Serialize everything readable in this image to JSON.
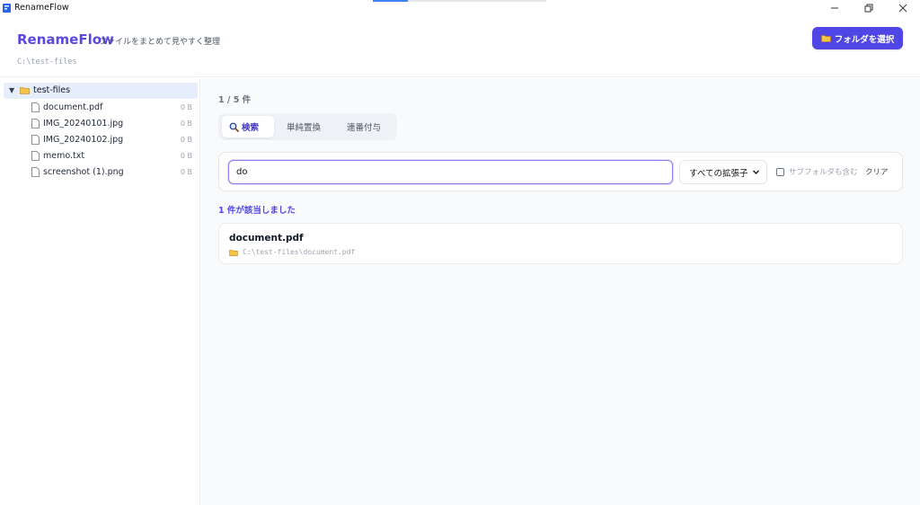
{
  "window": {
    "title": "RenameFlow",
    "loading_progress": 0.2
  },
  "header": {
    "brand": "RenameFlow",
    "tagline": "ファイルをまとめて見やすく整理",
    "current_path": "C:\\test-files",
    "select_folder_label": "フォルダを選択"
  },
  "sidebar": {
    "root": {
      "label": "test-files",
      "expanded": true
    },
    "files": [
      {
        "name": "document.pdf",
        "size": "0 B"
      },
      {
        "name": "IMG_20240101.jpg",
        "size": "0 B"
      },
      {
        "name": "IMG_20240102.jpg",
        "size": "0 B"
      },
      {
        "name": "memo.txt",
        "size": "0 B"
      },
      {
        "name": "screenshot (1).png",
        "size": "0 B"
      }
    ]
  },
  "main": {
    "count": "1 / 5 件",
    "tabs": [
      {
        "label": "検索",
        "icon": "magnifier-icon",
        "active": true
      },
      {
        "label": "単純置換",
        "active": false
      },
      {
        "label": "連番付与",
        "active": false
      }
    ],
    "search": {
      "value": "do",
      "extension_filter": "すべての拡張子",
      "subfolder_label": "サブフォルダも含む",
      "subfolder_checked": false,
      "clear_label": "クリア"
    },
    "match_text": "1 件が該当しました",
    "results": [
      {
        "name": "document.pdf",
        "path": "C:\\test-files\\document.pdf"
      }
    ]
  },
  "colors": {
    "accent": "#4f46e5",
    "brand": "#5b47e0",
    "selected_row": "#e6eefb",
    "folder": "#f5c542"
  }
}
